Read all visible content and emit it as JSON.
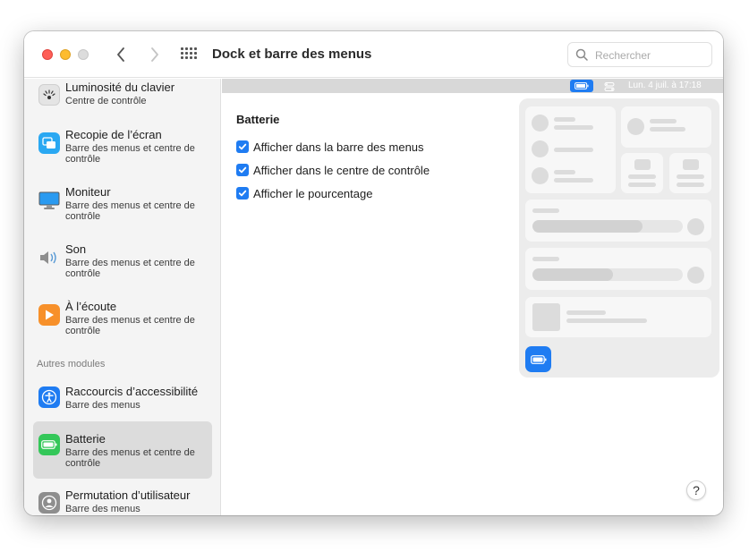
{
  "window": {
    "title": "Dock et barre des menus"
  },
  "search": {
    "placeholder": "Rechercher"
  },
  "sidebar": {
    "items": [
      {
        "name": "Luminosité du clavier",
        "sub": "Centre de contrôle",
        "icon": "keyboard-brightness-icon"
      },
      {
        "name": "Recopie de l’écran",
        "sub": "Barre des menus et centre de contrôle",
        "icon": "screen-mirroring-icon"
      },
      {
        "name": "Moniteur",
        "sub": "Barre des menus et centre de contrôle",
        "icon": "display-icon"
      },
      {
        "name": "Son",
        "sub": "Barre des menus et centre de contrôle",
        "icon": "speaker-icon"
      },
      {
        "name": "À l’écoute",
        "sub": "Barre des menus et centre de contrôle",
        "icon": "now-playing-icon"
      }
    ],
    "section_label": "Autres modules",
    "other_items": [
      {
        "name": "Raccourcis d’accessibilité",
        "sub": "Barre des menus",
        "icon": "accessibility-icon"
      },
      {
        "name": "Batterie",
        "sub": "Barre des menus et centre de contrôle",
        "icon": "battery-icon",
        "selected": true
      },
      {
        "name": "Permutation d’utilisateur",
        "sub": "Barre des menus",
        "icon": "user-switch-icon"
      }
    ]
  },
  "menubar_preview": {
    "clock": "Lun. 4 juil. à  17:18"
  },
  "content": {
    "section_title": "Batterie",
    "options": [
      {
        "label": "Afficher dans la barre des menus",
        "checked": true
      },
      {
        "label": "Afficher dans le centre de contrôle",
        "checked": true
      },
      {
        "label": "Afficher le pourcentage",
        "checked": true
      }
    ]
  },
  "help": {
    "label": "?"
  },
  "colors": {
    "accent": "#1f7cf2",
    "sidebar_bg": "#f4f4f4",
    "selected_bg": "#dcdcdc"
  }
}
